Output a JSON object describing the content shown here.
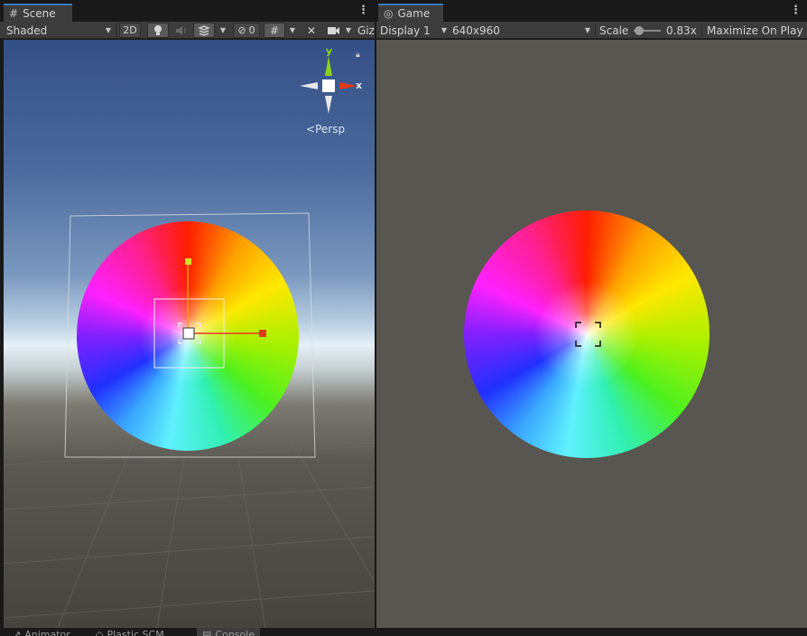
{
  "scene": {
    "tab_label": "Scene",
    "tab_icon": "grid-icon",
    "toolbar": {
      "shading_mode": "Shaded",
      "mode_2d": "2D",
      "hidden_count": "0",
      "gizmos_label": "Giz"
    },
    "orientation": {
      "y": "y",
      "x": "x",
      "persp": "Persp"
    }
  },
  "game": {
    "tab_label": "Game",
    "tab_icon": "gamepad-icon",
    "toolbar": {
      "display": "Display 1",
      "resolution": "640x960",
      "scale_label": "Scale",
      "scale_value": "0.83x",
      "maximize": "Maximize On Play"
    }
  },
  "bottom_tabs": [
    {
      "label": "Animator",
      "icon": "animator-icon"
    },
    {
      "label": "Plastic SCM",
      "icon": "plastic-icon"
    },
    {
      "label": "Console",
      "icon": "console-icon"
    }
  ],
  "colors": {
    "tab_accent": "#3a79bb",
    "toolbar_bg": "#3c3c3c",
    "game_bg": "#585650",
    "gizmo_x": "#e03a1e",
    "gizmo_y": "#8cd318",
    "selection_outline": "#ffffff"
  }
}
